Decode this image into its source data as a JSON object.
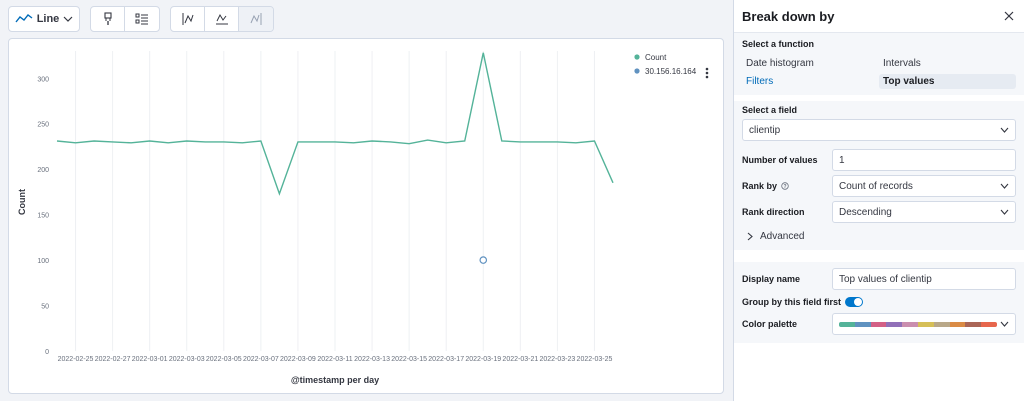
{
  "toolbar": {
    "chart_type": "Line"
  },
  "chart_data": {
    "type": "line",
    "xlabel": "@timestamp per day",
    "ylabel": "Count",
    "ylim": [
      0,
      330
    ],
    "yticks": [
      0,
      50,
      100,
      150,
      200,
      250,
      300
    ],
    "x_tick_labels": [
      "2022-02-25",
      "2022-02-27",
      "2022-03-01",
      "2022-03-03",
      "2022-03-05",
      "2022-03-07",
      "2022-03-09",
      "2022-03-11",
      "2022-03-13",
      "2022-03-15",
      "2022-03-17",
      "2022-03-19",
      "2022-03-21",
      "2022-03-23",
      "2022-03-25"
    ],
    "x": [
      "2022-02-24",
      "2022-02-25",
      "2022-02-26",
      "2022-02-27",
      "2022-02-28",
      "2022-03-01",
      "2022-03-02",
      "2022-03-03",
      "2022-03-04",
      "2022-03-05",
      "2022-03-06",
      "2022-03-07",
      "2022-03-08",
      "2022-03-09",
      "2022-03-10",
      "2022-03-11",
      "2022-03-12",
      "2022-03-13",
      "2022-03-14",
      "2022-03-15",
      "2022-03-16",
      "2022-03-17",
      "2022-03-18",
      "2022-03-19",
      "2022-03-20",
      "2022-03-21",
      "2022-03-22",
      "2022-03-23",
      "2022-03-24",
      "2022-03-25",
      "2022-03-26"
    ],
    "series": [
      {
        "name": "Count",
        "color": "#54b399",
        "values": [
          231,
          229,
          231,
          230,
          229,
          231,
          229,
          231,
          230,
          230,
          229,
          231,
          173,
          230,
          230,
          230,
          229,
          231,
          230,
          228,
          232,
          229,
          231,
          328,
          231,
          230,
          230,
          230,
          229,
          231,
          185
        ]
      },
      {
        "name": "30.156.16.164",
        "color": "#6092c0",
        "points": [
          {
            "x": "2022-03-19",
            "y": 100
          }
        ]
      }
    ],
    "legend_position": "top-right",
    "grid": "vertical"
  },
  "panel": {
    "title": "Break down by",
    "function_label": "Select a function",
    "functions": [
      {
        "label": "Date histogram",
        "state": "normal"
      },
      {
        "label": "Intervals",
        "state": "normal"
      },
      {
        "label": "Filters",
        "state": "link"
      },
      {
        "label": "Top values",
        "state": "selected"
      }
    ],
    "field_label": "Select a field",
    "field_value": "clientip",
    "number_of_values_label": "Number of values",
    "number_of_values": "1",
    "rank_by_label": "Rank by",
    "rank_by_value": "Count of records",
    "rank_direction_label": "Rank direction",
    "rank_direction_value": "Descending",
    "advanced_label": "Advanced",
    "display_name_label": "Display name",
    "display_name_value": "Top values of clientip",
    "group_first_label": "Group by this field first",
    "group_first_on": true,
    "color_palette_label": "Color palette",
    "palette_colors": [
      "#54b399",
      "#6092c0",
      "#d36086",
      "#9170b8",
      "#ca8eae",
      "#d6bf57",
      "#b9a888",
      "#da8b45",
      "#aa6556",
      "#e7664c"
    ]
  }
}
